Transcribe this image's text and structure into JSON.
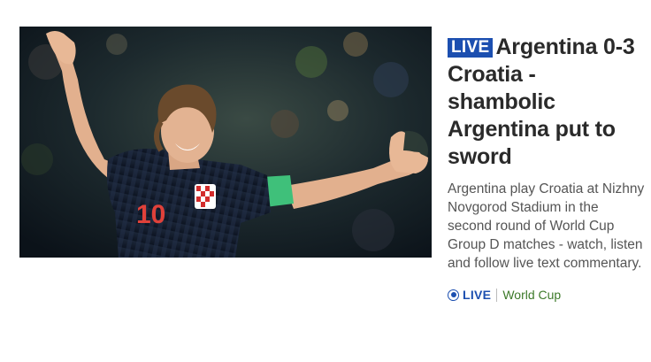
{
  "story": {
    "badge": "LIVE",
    "headline": "Argentina 0-3 Croatia - shambolic Argentina put to sword",
    "summary": "Argentina play Croatia at Nizhny Novgorod Stadium in the second round of World Cup Group D matches - watch, listen and follow live text commentary.",
    "meta": {
      "live_label": "LIVE",
      "topic": "World Cup"
    },
    "image": {
      "shirt_number": "10"
    }
  },
  "colors": {
    "live_blue": "#1c4fb0",
    "topic_green": "#3d7a2a",
    "headline_text": "#2a2a2a",
    "summary_text": "#555555"
  }
}
